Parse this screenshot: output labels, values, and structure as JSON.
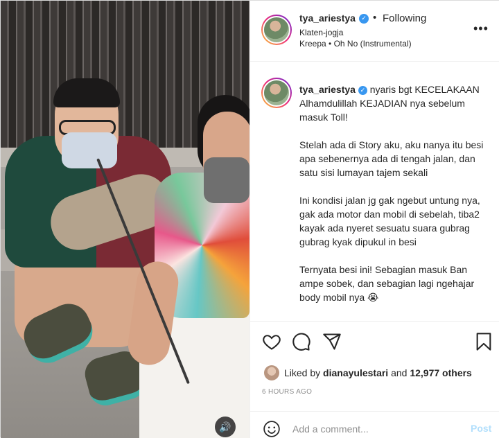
{
  "post": {
    "username": "tya_ariestya",
    "follow_status": "Following",
    "location": "Klaten-jogja",
    "audio": "Kreepa • Oh No (Instrumental)",
    "caption_paragraphs": [
      "nyaris bgt KECELAKAAN Alhamdulillah KEJADIAN nya sebelum masuk Toll!",
      "Stelah ada di Story aku, aku nanya itu besi apa sebenernya ada di tengah jalan, dan satu sisi lumayan tajem sekali",
      "Ini kondisi jalan jg gak ngebut untung nya, gak ada motor dan mobil di sebelah, tiba2 kayak ada nyeret sesuatu suara gubrag gubrag kyak dipukul in besi",
      "Ternyata besi ini! Sebagian masuk Ban ampe sobek, dan sebagian lagi ngehajar body mobil nya 😭"
    ],
    "liked_by_prefix": "Liked by",
    "liked_by_user": "dianayulestari",
    "liked_by_and": "and",
    "liked_by_others": "12,977 others",
    "time_ago": "6 HOURS AGO",
    "comment_placeholder": "Add a comment...",
    "post_label": "Post"
  },
  "icons": {
    "verified": "verified-badge-icon",
    "more": "more-options-icon",
    "like": "heart-icon",
    "comment": "comment-icon",
    "share": "share-icon",
    "save": "bookmark-icon",
    "emoji": "emoji-icon",
    "sound": "speaker-icon"
  },
  "colors": {
    "text": "#262626",
    "secondary": "#8e8e8e",
    "verified": "#3897f0",
    "post_disabled": "#b2dffc"
  }
}
